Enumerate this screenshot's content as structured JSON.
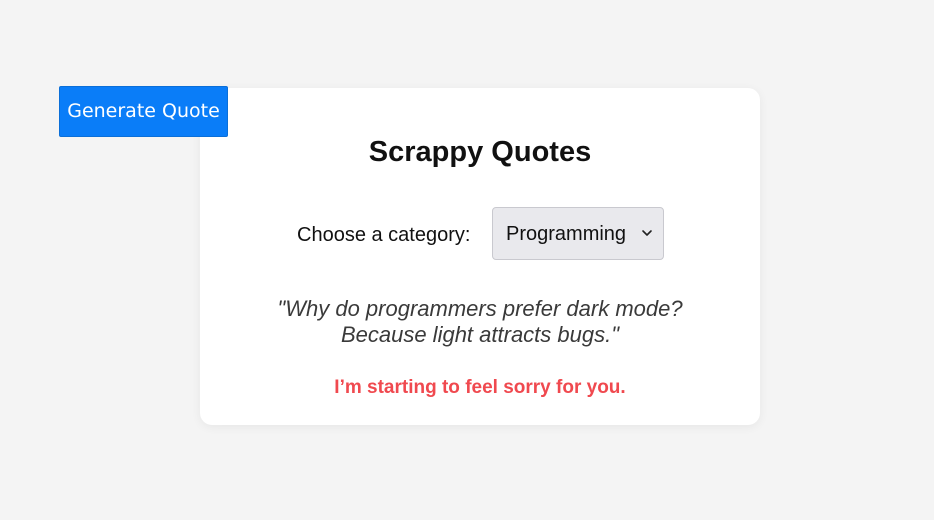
{
  "toolbar": {
    "generate_label": "Generate Quote"
  },
  "card": {
    "title": "Scrappy Quotes",
    "category_label": "Choose a category:",
    "category_selected": "Programming",
    "quote_line_1": "\"Why do programmers prefer dark mode?",
    "quote_line_2": "Because light attracts bugs.\"",
    "feedback": "I’m starting to feel sorry for you."
  },
  "colors": {
    "page_background": "#f4f4f4",
    "button_accent": "#0a7df8",
    "feedback_text": "#f0494f",
    "card_background": "#ffffff"
  },
  "icons": {
    "select_arrow": "chevron-down-icon"
  }
}
